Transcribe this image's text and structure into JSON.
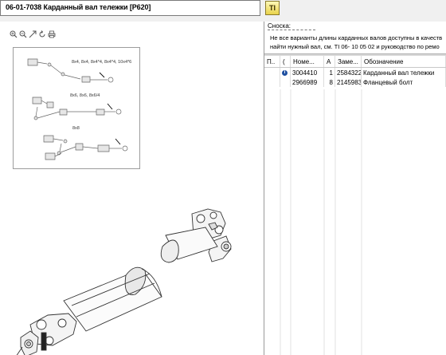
{
  "header": {
    "title": "06-01-7038 Карданный вал тележки [P620]",
    "ti_button": "TI"
  },
  "toolbar": {
    "icons": [
      "zoom-in-icon",
      "zoom-out-icon",
      "fit-icon",
      "rotate-icon",
      "print-icon"
    ]
  },
  "thumbnail": {
    "labels": [
      "8x4, 8x4, 8x4*4, 8x4*4, 10x4*6",
      "8x6, 8x6, 8x6/4",
      "8x8"
    ]
  },
  "note": {
    "title": "Сноска:",
    "line1": "Не все варианты длины карданных валов доступны в качеств",
    "line2": "найти нужный вал, см. TI 06- 10  05 02 и руководство по ремо"
  },
  "table": {
    "columns": [
      "П..",
      "(",
      "Номе...",
      "А",
      "Заме...",
      "Обозначение"
    ],
    "rows": [
      {
        "info": true,
        "number": "3004410",
        "qty": "1",
        "replaced": "2584322",
        "designation": "Карданный вал тележки"
      },
      {
        "info": false,
        "number": "2966989",
        "qty": "8",
        "replaced": "2145983",
        "designation": "Фланцевый болт"
      }
    ]
  },
  "colors": {
    "panel_bg": "#f0f0f0",
    "info_icon": "#1e4fa0",
    "ti_button": "#e8d24a"
  }
}
